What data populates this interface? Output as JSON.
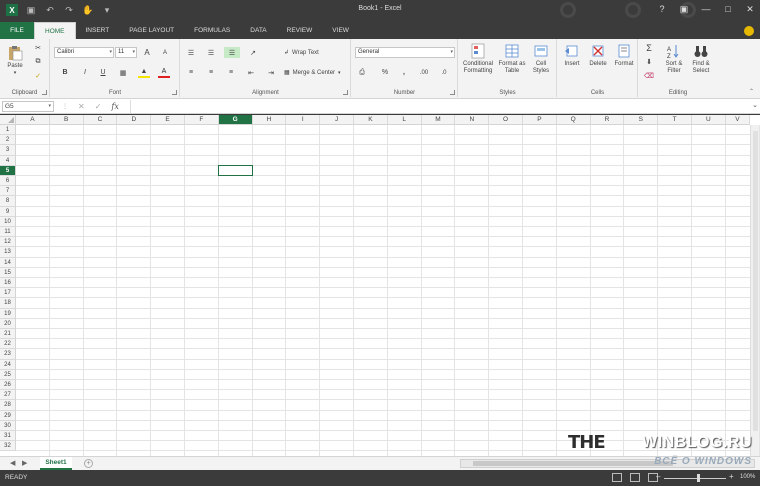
{
  "window": {
    "title": "Book1 - Excel"
  },
  "tabs": [
    "FILE",
    "HOME",
    "INSERT",
    "PAGE LAYOUT",
    "FORMULAS",
    "DATA",
    "REVIEW",
    "VIEW"
  ],
  "ribbon": {
    "clipboard": {
      "label": "Clipboard",
      "paste": "Paste"
    },
    "font": {
      "label": "Font",
      "name": "Calibri",
      "size": "11",
      "bold": "B",
      "italic": "I",
      "underline": "U",
      "grow": "A",
      "shrink": "A"
    },
    "alignment": {
      "label": "Alignment",
      "wrap": "Wrap Text",
      "merge": "Merge & Center"
    },
    "number": {
      "label": "Number",
      "format": "General",
      "percent": "%",
      "comma": ","
    },
    "styles": {
      "label": "Styles",
      "conditional": [
        "Conditional",
        "Formatting"
      ],
      "table": [
        "Format as",
        "Table"
      ],
      "cell": [
        "Cell",
        "Styles"
      ]
    },
    "cells": {
      "label": "Cells",
      "insert": "Insert",
      "delete": "Delete",
      "format": "Format"
    },
    "editing": {
      "label": "Editing",
      "sort": [
        "Sort &",
        "Filter"
      ],
      "find": [
        "Find &",
        "Select"
      ]
    }
  },
  "formula_bar": {
    "name_box": "G5",
    "fx": "fx",
    "value": ""
  },
  "grid": {
    "columns": [
      "A",
      "B",
      "C",
      "D",
      "E",
      "F",
      "G",
      "H",
      "I",
      "J",
      "K",
      "L",
      "M",
      "N",
      "O",
      "P",
      "Q",
      "R",
      "S",
      "T",
      "U",
      "V"
    ],
    "selected_column": "G",
    "selected_row": 5,
    "row_count": 32
  },
  "sheet_tabs": [
    "Sheet1"
  ],
  "status": {
    "text": "READY",
    "zoom": "100%"
  },
  "watermark": {
    "big": "THE",
    "main": "WINBLOG.RU",
    "sub": "ВСЁ О WINDOWS"
  }
}
